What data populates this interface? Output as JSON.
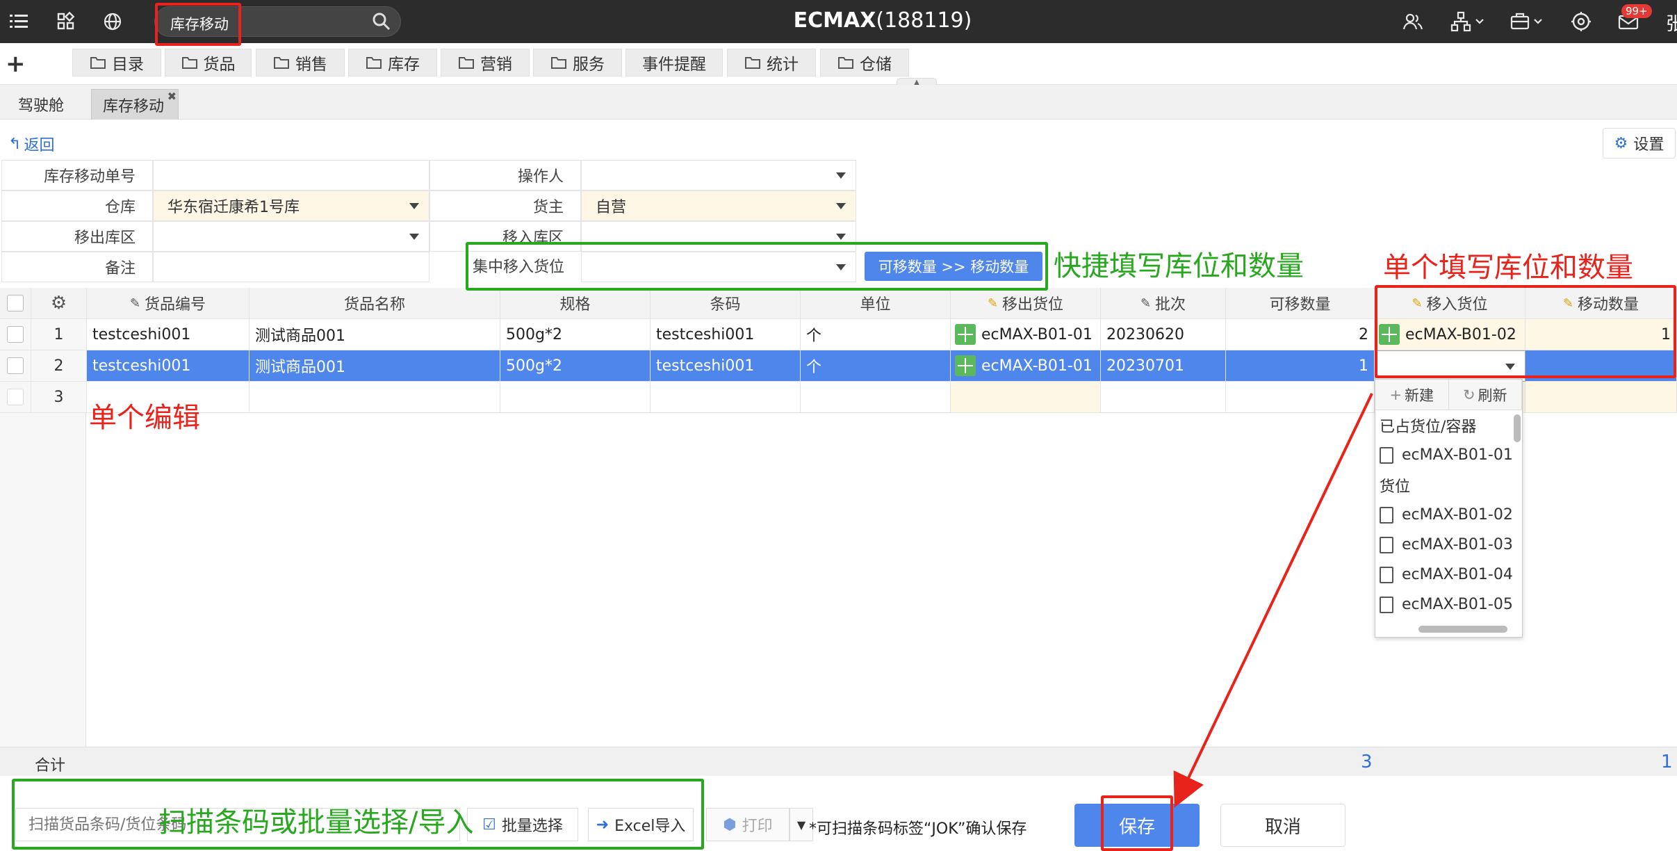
{
  "topbar": {
    "search_text": "库存移动",
    "app_name": "ECMAX",
    "app_code": "(188119)",
    "notification_badge": "99+",
    "user_initial": "张"
  },
  "menu": {
    "items": [
      "目录",
      "货品",
      "销售",
      "库存",
      "营销",
      "服务",
      "事件提醒",
      "统计",
      "仓储"
    ]
  },
  "tabs": [
    {
      "label": "驾驶舱"
    },
    {
      "label": "库存移动"
    }
  ],
  "actions": {
    "back": "返回",
    "settings": "设置"
  },
  "form": {
    "move_no_label": "库存移动单号",
    "move_no_value": "",
    "operator_label": "操作人",
    "operator_value": "",
    "warehouse_label": "仓库",
    "warehouse_value": "华东宿迁康希1号库",
    "owner_label": "货主",
    "owner_value": "自营",
    "out_area_label": "移出库区",
    "out_area_value": "",
    "in_area_label": "移入库区",
    "in_area_value": "",
    "remark_label": "备注",
    "remark_value": "",
    "batch_loc_label": "集中移入货位",
    "batch_loc_value": "",
    "fill_button": "可移数量 >> 移动数量"
  },
  "annotations": {
    "quick_fill": "快捷填写库位和数量",
    "single_fill": "单个填写库位和数量",
    "single_edit": "单个编辑",
    "scan_or_batch": "扫描条码或批量选择/导入"
  },
  "grid": {
    "columns": [
      "货品编号",
      "货品名称",
      "规格",
      "条码",
      "单位",
      "移出货位",
      "批次",
      "可移数量",
      "移入货位",
      "移动数量"
    ],
    "rows": [
      {
        "no": "1",
        "code": "testceshi001",
        "name": "测试商品001",
        "spec": "500g*2",
        "barcode": "testceshi001",
        "unit": "个",
        "out_loc": "ecMAX-B01-01",
        "batch": "20230620",
        "avail": "2",
        "in_loc": "ecMAX-B01-02",
        "qty": "1"
      },
      {
        "no": "2",
        "code": "testceshi001",
        "name": "测试商品001",
        "spec": "500g*2",
        "barcode": "testceshi001",
        "unit": "个",
        "out_loc": "ecMAX-B01-01",
        "batch": "20230701",
        "avail": "1",
        "in_loc": "",
        "qty": ""
      },
      {
        "no": "3",
        "code": "",
        "name": "",
        "spec": "",
        "barcode": "",
        "unit": "",
        "out_loc": "",
        "batch": "",
        "avail": "",
        "in_loc": "",
        "qty": ""
      }
    ]
  },
  "dropdown": {
    "new": "新建",
    "refresh": "刷新",
    "group_occupied": "已占货位/容器",
    "occupied_items": [
      "ecMAX-B01-01"
    ],
    "group_locations": "货位",
    "location_items": [
      "ecMAX-B01-02",
      "ecMAX-B01-03",
      "ecMAX-B01-04",
      "ecMAX-B01-05"
    ]
  },
  "totals": {
    "label": "合计",
    "avail_total": "3",
    "qty_total": "1"
  },
  "footer": {
    "scan_placeholder": "扫描货品条码/货位条码",
    "batch_select": "批量选择",
    "excel_import": "Excel导入",
    "print": "打印",
    "hint": "*可扫描条码标签“JOK”确认保存",
    "save": "保存",
    "cancel": "取消"
  },
  "colors": {
    "accent_blue": "#4f86ec",
    "annotation_red": "#e8231c",
    "annotation_green": "#27a81e",
    "topbar_bg": "#2c2c2c"
  }
}
